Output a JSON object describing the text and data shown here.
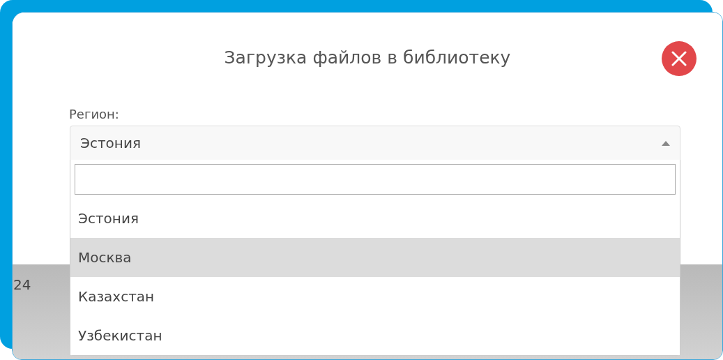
{
  "dialog": {
    "title": "Загрузка файлов в библиотеку"
  },
  "region": {
    "label": "Регион:",
    "value": "Эстония",
    "expanded": true,
    "options": [
      {
        "label": "Эстония",
        "highlighted": false
      },
      {
        "label": "Москва",
        "highlighted": true
      },
      {
        "label": "Казахстан",
        "highlighted": false
      },
      {
        "label": "Узбекистан",
        "highlighted": false
      }
    ]
  },
  "background": {
    "text": "24"
  }
}
